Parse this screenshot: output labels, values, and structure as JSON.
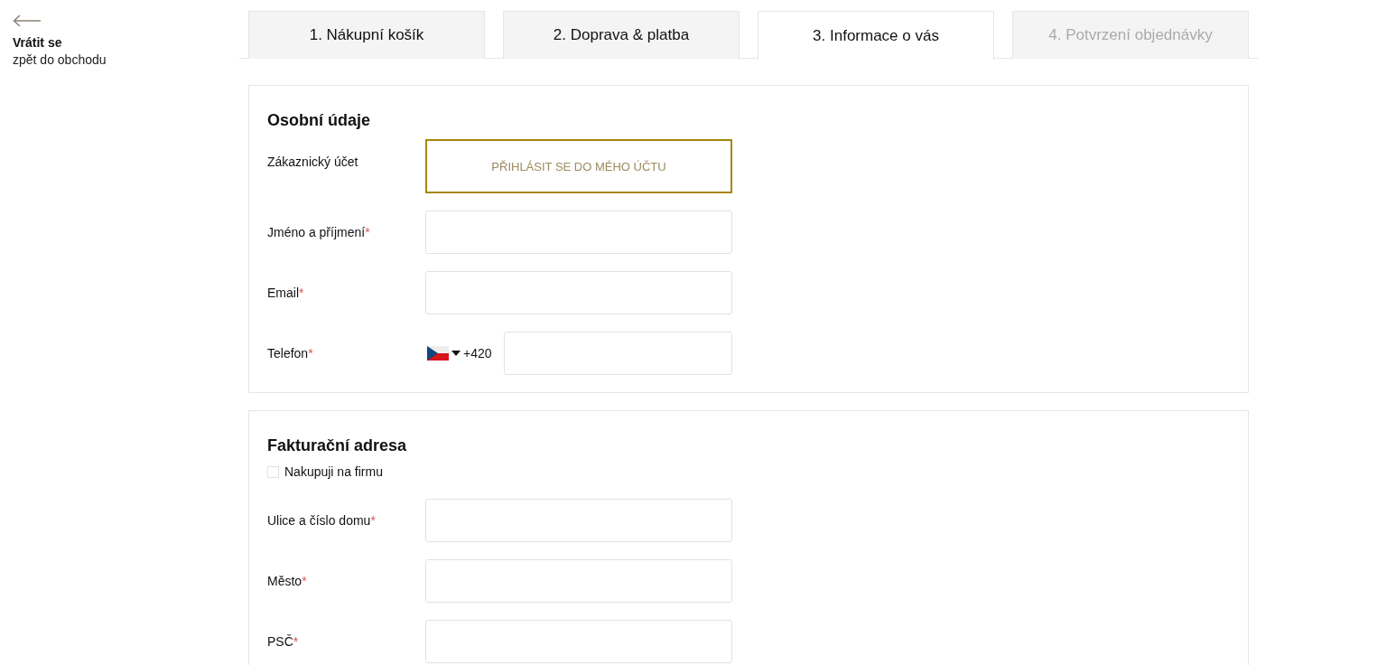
{
  "back_link": {
    "title": "Vrátit se",
    "subtitle": "zpět do obchodu"
  },
  "tabs": [
    {
      "label": "1. Nákupní košík",
      "selected": false,
      "disabled": false
    },
    {
      "label": "2. Doprava & platba",
      "selected": false,
      "disabled": false
    },
    {
      "label": "3. Informace o vás",
      "selected": true,
      "disabled": false
    },
    {
      "label": "4. Potvrzení objednávky",
      "selected": false,
      "disabled": true
    }
  ],
  "sections": [
    {
      "title": "Osobní údaje",
      "rows": [
        {
          "kind": "button",
          "label": "Zákaznický účet",
          "button": "PŘIHLÁSIT SE DO MÉHO ÚČTU"
        },
        {
          "kind": "text",
          "label": "Jméno a příjmení",
          "mark": "*"
        },
        {
          "kind": "text",
          "label": "Email",
          "mark": "*"
        },
        {
          "kind": "phone",
          "label": "Telefon",
          "mark": "*",
          "prefix": "+420"
        }
      ]
    },
    {
      "title": "Fakturační adresa",
      "rows": [
        {
          "kind": "checkbox",
          "label": "Nakupuji na firmu",
          "checked": false
        },
        {
          "kind": "text",
          "label": "Ulice a číslo domu",
          "mark": "*"
        },
        {
          "kind": "text",
          "label": "Město",
          "mark": "*"
        },
        {
          "kind": "text",
          "label": "PSČ",
          "mark": "*"
        }
      ]
    }
  ]
}
